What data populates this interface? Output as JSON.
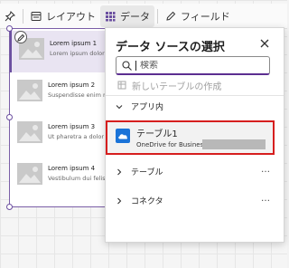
{
  "toolbar": {
    "items": [
      {
        "icon": "pin-icon",
        "label": ""
      },
      {
        "icon": "layout-icon",
        "label": "レイアウト"
      },
      {
        "icon": "data-grid-icon",
        "label": "データ"
      },
      {
        "icon": "field-edit-icon",
        "label": "フィールド"
      }
    ],
    "active_index": 2
  },
  "gallery": {
    "items": [
      {
        "title": "Lorem ipsum 1",
        "subtitle": "Lorem ipsum dolor sit amet,"
      },
      {
        "title": "Lorem ipsum 2",
        "subtitle": "Suspendisse enim metus, sit"
      },
      {
        "title": "Lorem ipsum 3",
        "subtitle": "Ut pharetra a dolor ac vel"
      },
      {
        "title": "Lorem ipsum 4",
        "subtitle": "Vestibulum dui felis, fringilla"
      }
    ]
  },
  "panel": {
    "title": "データ ソースの選択",
    "search_placeholder": "検索",
    "new_table_label": "新しいテーブルの作成",
    "sections": {
      "in_app": "アプリ内",
      "tables": "テーブル",
      "connectors": "コネクタ"
    },
    "more_label": "…",
    "datasource": {
      "name": "テーブル1",
      "subtitle": "OneDrive for Business -"
    }
  },
  "colors": {
    "accent": "#5c2e91",
    "highlight_border": "#d61e1e",
    "onedrive_blue": "#1a73d8"
  }
}
